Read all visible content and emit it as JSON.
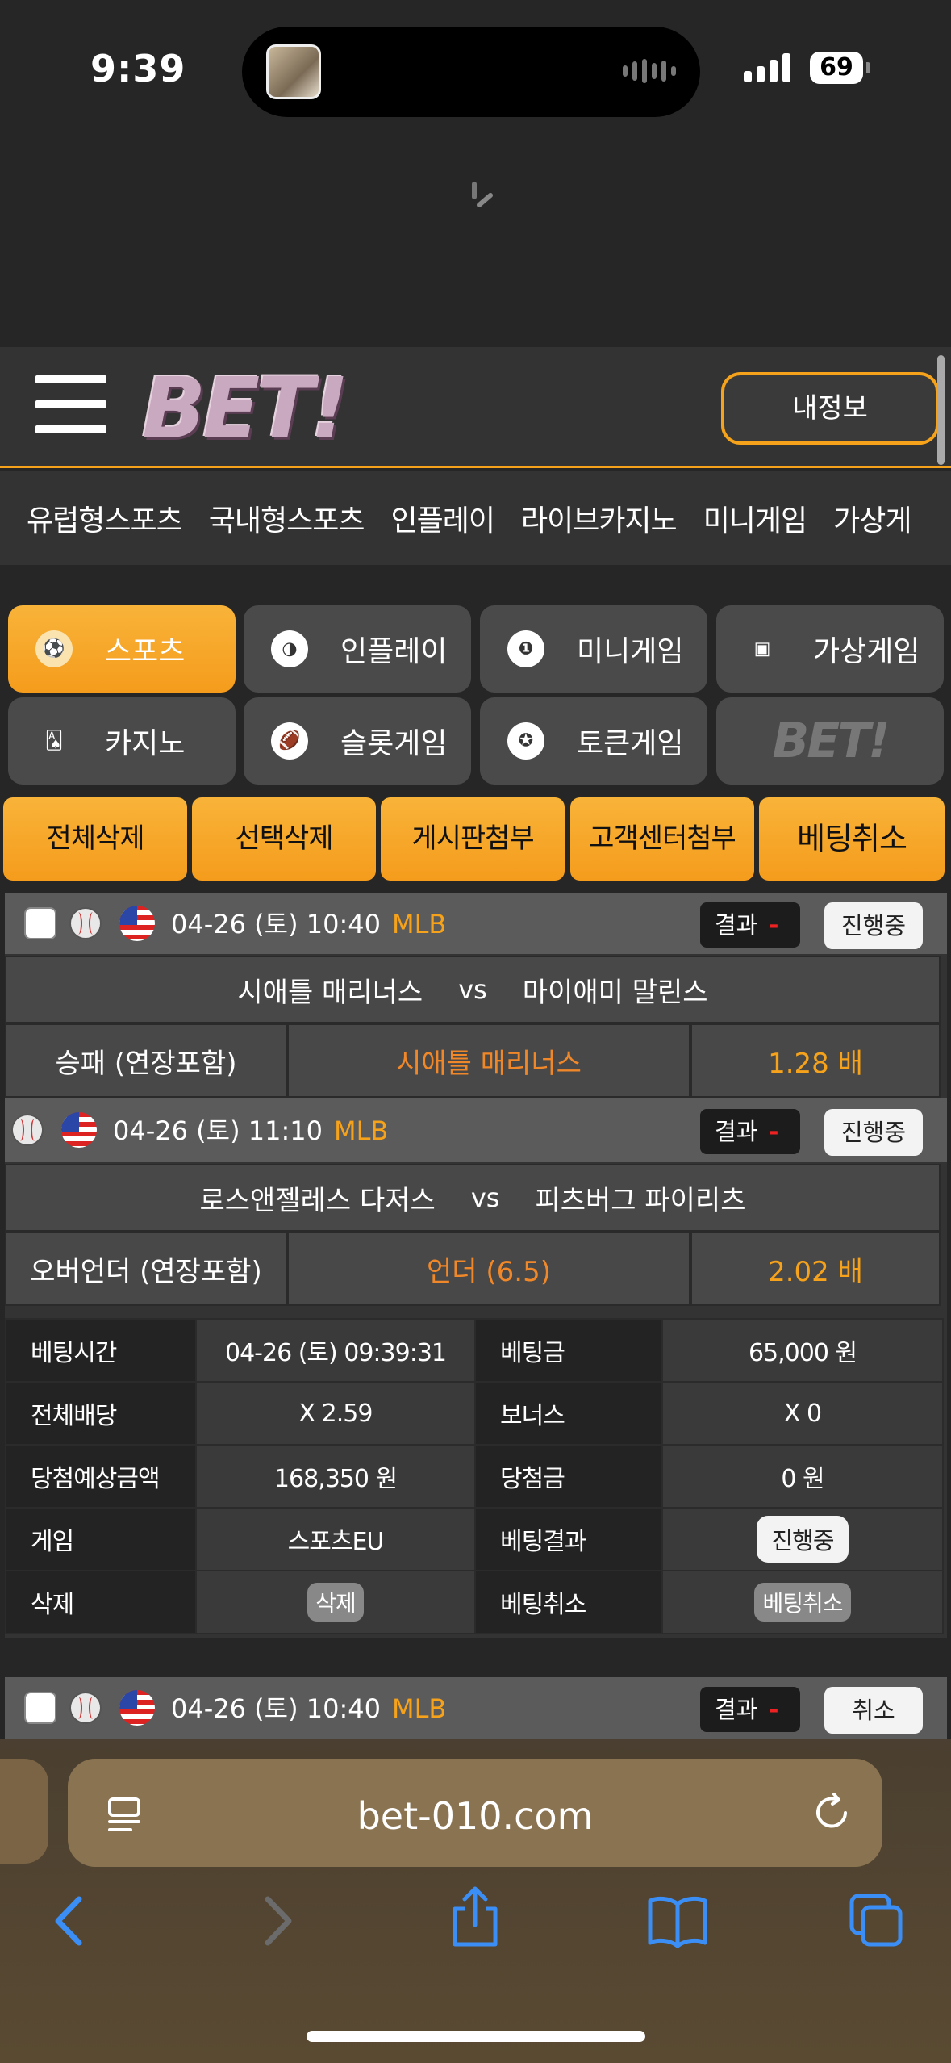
{
  "status": {
    "time": "9:39",
    "battery": "69"
  },
  "header": {
    "logo": "BET!",
    "myinfo_label": "내정보"
  },
  "nav": [
    "유럽형스포츠",
    "국내형스포츠",
    "인플레이",
    "라이브카지노",
    "미니게임",
    "가상게"
  ],
  "categories": [
    {
      "label": "스포츠",
      "icon": "soccer-ball-icon",
      "active": true
    },
    {
      "label": "인플레이",
      "icon": "volleyball-icon",
      "active": false
    },
    {
      "label": "미니게임",
      "icon": "number-ball-icon",
      "active": false
    },
    {
      "label": "가상게임",
      "icon": "slot-machine-icon",
      "active": false
    },
    {
      "label": "카지노",
      "icon": "playing-cards-icon",
      "active": false
    },
    {
      "label": "슬롯게임",
      "icon": "football-icon",
      "active": false
    },
    {
      "label": "토큰게임",
      "icon": "poker-chip-icon",
      "active": false
    },
    {
      "label": "BET!",
      "icon": "bet-logo",
      "active": false
    }
  ],
  "actions": [
    "전체삭제",
    "선택삭제",
    "게시판첨부",
    "고객센터첨부",
    "베팅취소"
  ],
  "bet1": {
    "match1": {
      "date": "04-26 (토) 10:40",
      "league": "MLB",
      "result_label": "결과",
      "result_value": "-",
      "status": "진행중",
      "home": "시애틀 매리너스",
      "vs": "vs",
      "away": "마이애미 말린스",
      "market": "승패 (연장포함)",
      "pick": "시애틀 매리너스",
      "odds": "1.28 배"
    },
    "match2": {
      "date": "04-26 (토) 11:10",
      "league": "MLB",
      "result_label": "결과",
      "result_value": "-",
      "status": "진행중",
      "home": "로스앤젤레스 다저스",
      "vs": "vs",
      "away": "피츠버그 파이리츠",
      "market": "오버언더 (연장포함)",
      "pick": "언더 (6.5)",
      "odds": "2.02 배"
    },
    "summary": {
      "bet_time_label": "베팅시간",
      "bet_time": "04-26 (토) 09:39:31",
      "bet_amount_label": "베팅금",
      "bet_amount": "65,000 원",
      "total_odds_label": "전체배당",
      "total_odds": "X 2.59",
      "bonus_label": "보너스",
      "bonus": "X 0",
      "expected_label": "당첨예상금액",
      "expected": "168,350 원",
      "win_label": "당첨금",
      "win": "0 원",
      "game_label": "게임",
      "game": "스포츠EU",
      "bet_result_label": "베팅결과",
      "bet_result": "진행중",
      "delete_label": "삭제",
      "delete_btn": "삭제",
      "cancel_label": "베팅취소",
      "cancel_btn": "베팅취소"
    }
  },
  "bet2": {
    "date": "04-26 (토) 10:40",
    "league": "MLB",
    "result_label": "결과",
    "result_value": "-",
    "status": "취소"
  },
  "browser": {
    "url": "bet-010.com"
  }
}
